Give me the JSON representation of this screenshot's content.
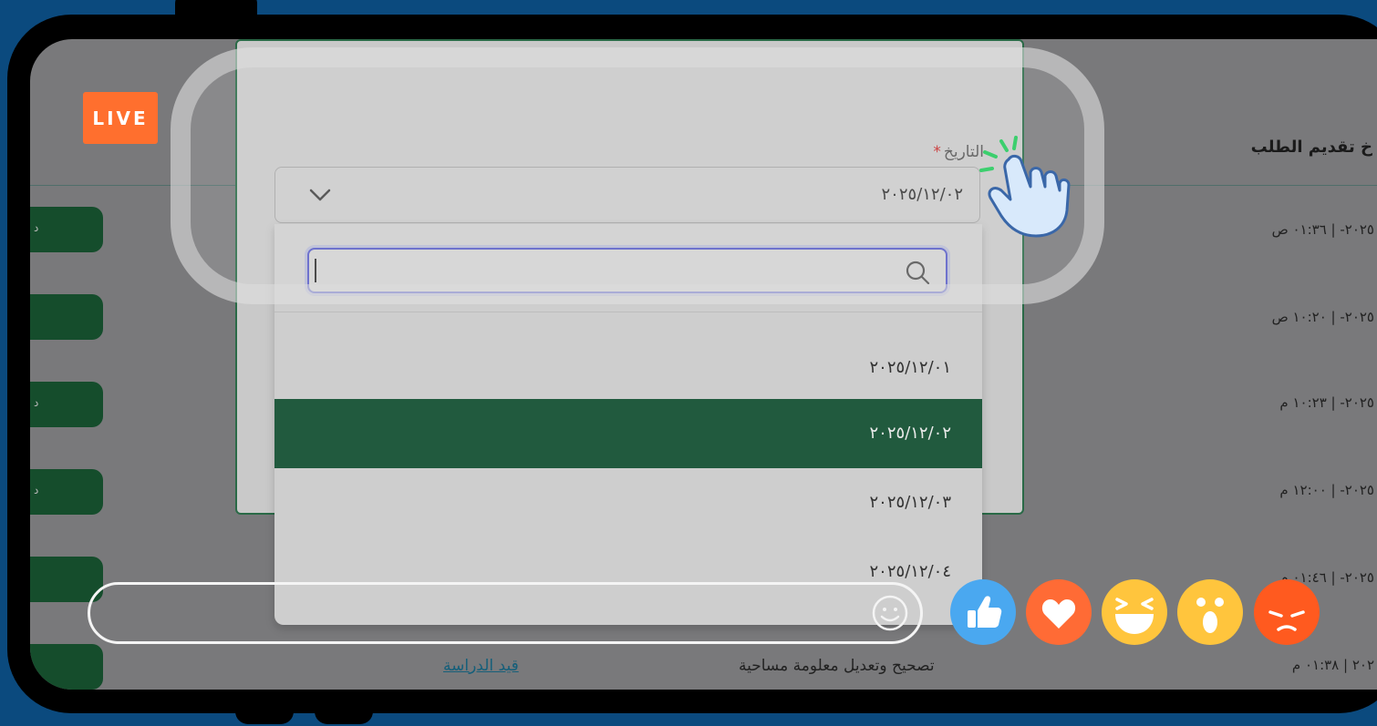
{
  "app": {
    "live_badge": "LIVE"
  },
  "background_table": {
    "header": "خ تقديم الطلب",
    "rows": [
      {
        "date": "٢٠٢٥- | ٠١:٣٦ ص"
      },
      {
        "date": "٢٠٢٥- | ١٠:٢٠ ص"
      },
      {
        "date": "٢٠٢٥- | ١٠:٢٣ م"
      },
      {
        "date": "٢٠٢٥- | ١٢:٠٠ م"
      },
      {
        "date": "٢٠٢٥- | ٠١:٤٦ م"
      },
      {
        "date": "٢٠٢ | ٠١:٣٨ م"
      }
    ],
    "pill_letter": "د",
    "last_row_service": "تصحيح وتعديل معلومة مساحية",
    "last_row_status": "قيد الدراسة"
  },
  "dialog": {
    "date_field": {
      "label": "التاريخ",
      "required_mark": "*",
      "selected_value": "٢٠٢٥/١٢/٠٢",
      "search_placeholder": ""
    },
    "options": [
      {
        "label": "٢٠٢٥/١٢/٠١",
        "selected": false
      },
      {
        "label": "٢٠٢٥/١٢/٠٢",
        "selected": true
      },
      {
        "label": "٢٠٢٥/١٢/٠٣",
        "selected": false
      },
      {
        "label": "٢٠٢٥/١٢/٠٤",
        "selected": false
      }
    ]
  },
  "comment_bar": {
    "placeholder": "",
    "icon": "smile-icon"
  },
  "reactions": [
    {
      "name": "like",
      "color": "#4aa8f0"
    },
    {
      "name": "love",
      "color": "#ff6b35"
    },
    {
      "name": "haha",
      "color": "#ffc53d"
    },
    {
      "name": "wow",
      "color": "#ffc53d"
    },
    {
      "name": "angry",
      "color": "#ff5a1f"
    }
  ],
  "colors": {
    "page_bg": "#0b4a7e",
    "selected_option": "#215a3e",
    "accent_live": "#ff6f2e"
  }
}
